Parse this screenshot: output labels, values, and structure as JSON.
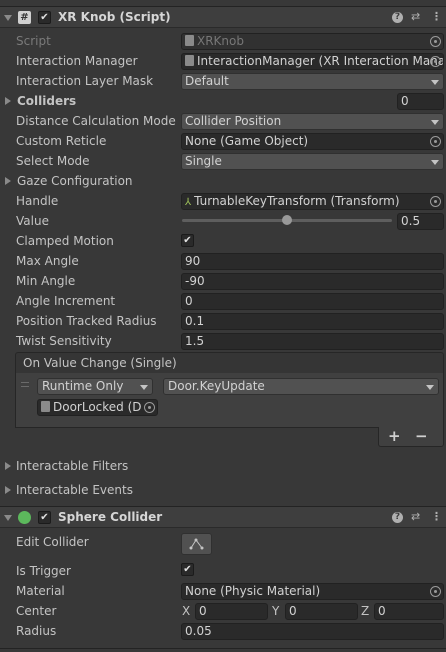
{
  "xrknob": {
    "title": "XR Knob (Script)",
    "script_label": "Script",
    "script_value": "XRKnob",
    "interaction_manager_label": "Interaction Manager",
    "interaction_manager_value": "InteractionManager (XR Interaction Mana",
    "interaction_layer_mask_label": "Interaction Layer Mask",
    "interaction_layer_mask_value": "Default",
    "colliders_label": "Colliders",
    "colliders_count": "0",
    "distance_calc_label": "Distance Calculation Mode",
    "distance_calc_value": "Collider Position",
    "custom_reticle_label": "Custom Reticle",
    "custom_reticle_value": "None (Game Object)",
    "select_mode_label": "Select Mode",
    "select_mode_value": "Single",
    "gaze_config_label": "Gaze Configuration",
    "handle_label": "Handle",
    "handle_value": "TurnableKeyTransform (Transform)",
    "value_label": "Value",
    "value_value": "0.5",
    "value_fraction": 0.5,
    "clamped_motion_label": "Clamped Motion",
    "clamped_motion_checked": "✔",
    "max_angle_label": "Max Angle",
    "max_angle_value": "90",
    "min_angle_label": "Min Angle",
    "min_angle_value": "-90",
    "angle_increment_label": "Angle Increment",
    "angle_increment_value": "0",
    "position_tracked_radius_label": "Position Tracked Radius",
    "position_tracked_radius_value": "0.1",
    "twist_sensitivity_label": "Twist Sensitivity",
    "twist_sensitivity_value": "1.5",
    "event": {
      "header": "On Value Change (Single)",
      "runtime_value": "Runtime Only",
      "function_value": "Door.KeyUpdate",
      "object_value": "DoorLocked (D",
      "add_label": "+",
      "remove_label": "−"
    },
    "interactable_filters_label": "Interactable Filters",
    "interactable_events_label": "Interactable Events"
  },
  "sphere": {
    "title": "Sphere Collider",
    "edit_collider_label": "Edit Collider",
    "is_trigger_label": "Is Trigger",
    "is_trigger_checked": "✔",
    "material_label": "Material",
    "material_value": "None (Physic Material)",
    "center_label": "Center",
    "center_x_label": "X",
    "center_x_value": "0",
    "center_y_label": "Y",
    "center_y_value": "0",
    "center_z_label": "Z",
    "center_z_value": "0",
    "radius_label": "Radius",
    "radius_value": "0.05"
  },
  "colors": {
    "panel": "#383838",
    "field": "#2a2a2a",
    "dropdown": "#515151",
    "accent_green": "#5cb85c"
  }
}
